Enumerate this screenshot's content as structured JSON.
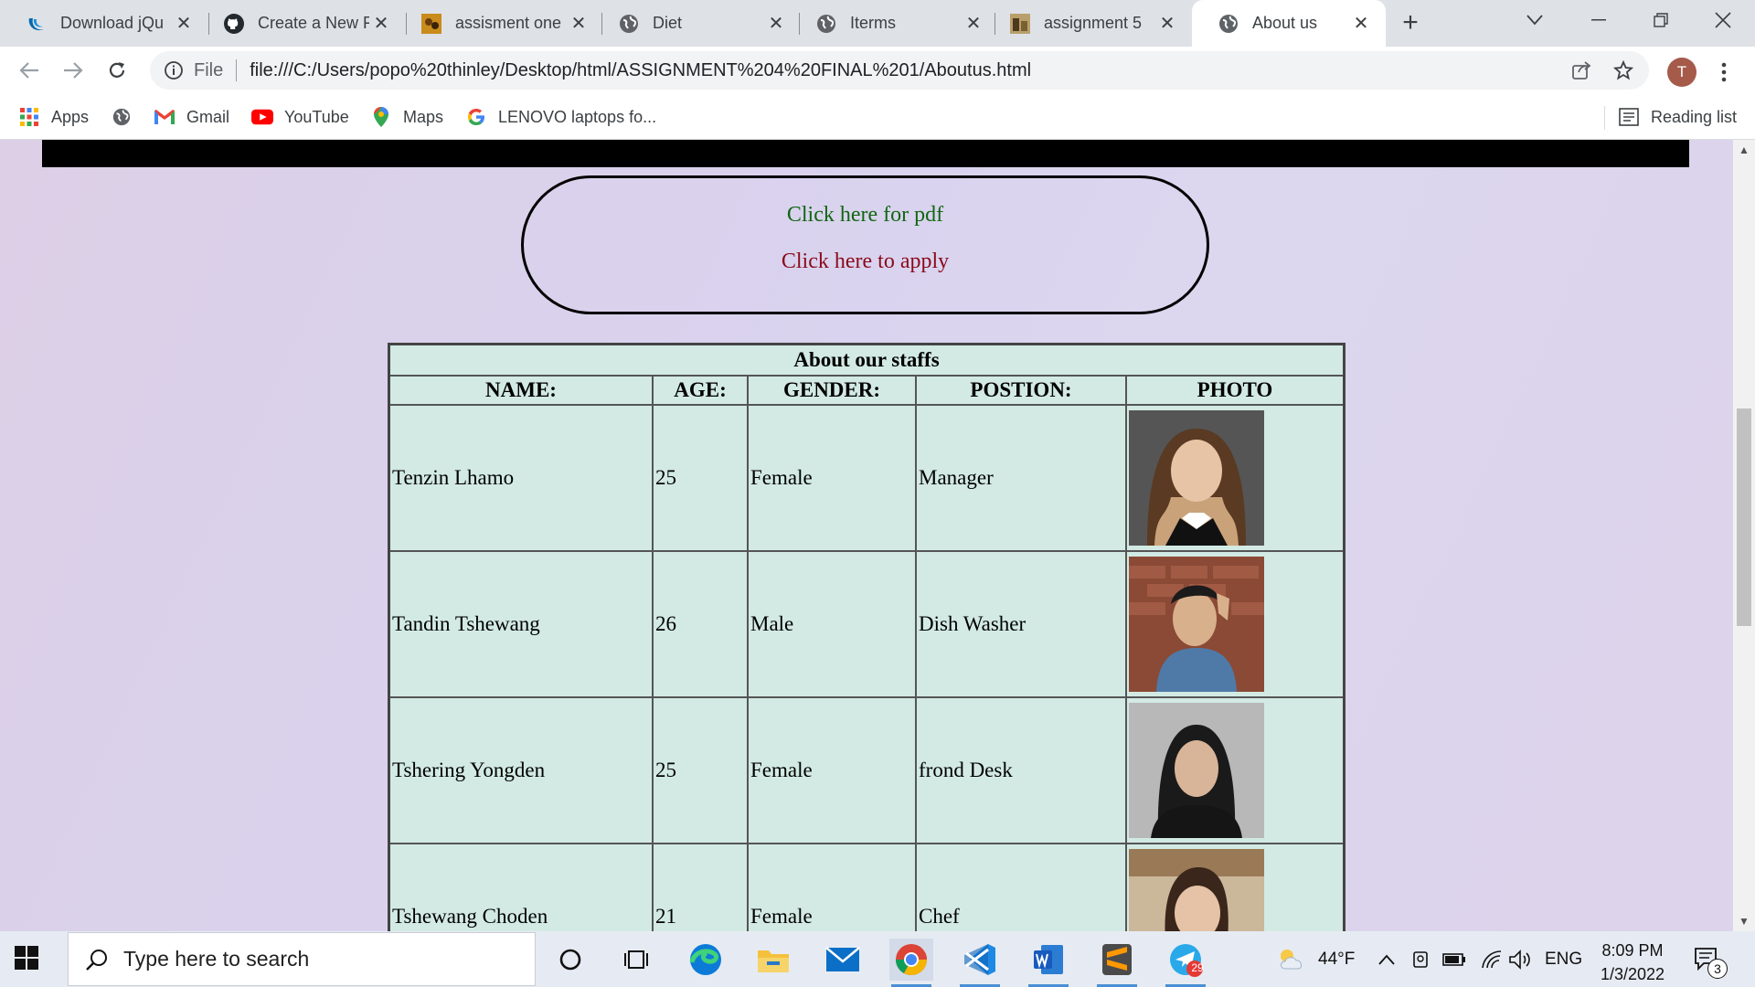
{
  "browser": {
    "tabs": [
      {
        "title": "Download jQu",
        "icon": "jquery-icon"
      },
      {
        "title": "Create a New F",
        "icon": "github-icon"
      },
      {
        "title": "assisment one",
        "icon": "site-image-icon"
      },
      {
        "title": "Diet",
        "icon": "globe-icon"
      },
      {
        "title": "Iterms",
        "icon": "globe-icon"
      },
      {
        "title": "assignment 5",
        "icon": "site-image-icon"
      },
      {
        "title": "About us",
        "icon": "globe-icon",
        "active": true
      }
    ],
    "address": {
      "scheme_label": "File",
      "url": "file:///C:/Users/popo%20thinley/Desktop/html/ASSIGNMENT%204%20FINAL%201/Aboutus.html"
    },
    "profile_initial": "T",
    "bookmarks": [
      {
        "label": "Apps",
        "icon": "apps-grid-icon"
      },
      {
        "label": "",
        "icon": "globe-icon"
      },
      {
        "label": "Gmail",
        "icon": "gmail-icon"
      },
      {
        "label": "YouTube",
        "icon": "youtube-icon"
      },
      {
        "label": "Maps",
        "icon": "maps-icon"
      },
      {
        "label": "LENOVO laptops fo...",
        "icon": "google-icon"
      }
    ],
    "reading_list": "Reading list"
  },
  "page": {
    "links": {
      "pdf": "Click here for pdf",
      "apply": "Click here to apply"
    },
    "table": {
      "caption": "About our staffs",
      "headers": [
        "NAME:",
        "AGE:",
        "GENDER:",
        "POSTION:",
        "PHOTO"
      ],
      "rows": [
        {
          "name": "Tenzin Lhamo",
          "age": "25",
          "gender": "Female",
          "position": "Manager"
        },
        {
          "name": "Tandin Tshewang",
          "age": "26",
          "gender": "Male",
          "position": "Dish Washer"
        },
        {
          "name": "Tshering Yongden",
          "age": "25",
          "gender": "Female",
          "position": "frond Desk"
        },
        {
          "name": "Tshewang Choden",
          "age": "21",
          "gender": "Female",
          "position": "Chef"
        }
      ]
    }
  },
  "taskbar": {
    "search_placeholder": "Type here to search",
    "weather": "44°F",
    "language": "ENG",
    "time": "8:09 PM",
    "date": "1/3/2022",
    "telegram_badge": "29",
    "notification_count": "3"
  },
  "colors": {
    "pdf_link": "#116611",
    "apply_link": "#8b0a1a",
    "table_bg": "#d2eae3",
    "page_bg": "#dcd3ec"
  }
}
